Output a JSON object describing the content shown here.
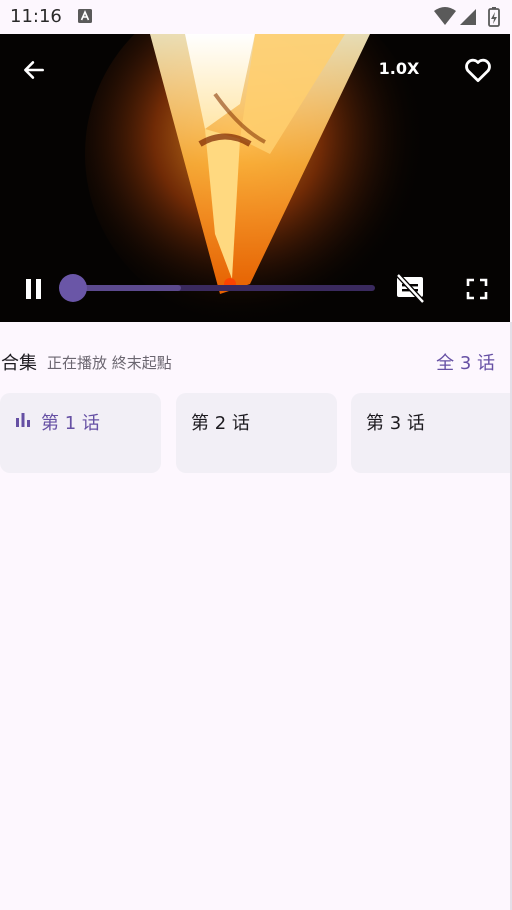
{
  "status_bar": {
    "time": "11:16",
    "icons": [
      "accessibility-icon",
      "wifi-icon",
      "signal-icon",
      "battery-icon"
    ]
  },
  "player": {
    "back_icon": "arrow-left-icon",
    "speed_label": "1.0X",
    "favorite_icon": "heart-outline-icon",
    "play_state_icon": "pause-icon",
    "subtitles_icon": "subtitles-off-icon",
    "fullscreen_icon": "fullscreen-icon",
    "progress_fraction": 0.0,
    "buffered_fraction": 0.36,
    "accent_color": "#6a56a7"
  },
  "episodes": {
    "title": "合集",
    "now_playing": "正在播放 終末起點",
    "total": "全 3 话",
    "items": [
      {
        "label": "第 1 话",
        "active": true,
        "icon": "equalizer-icon"
      },
      {
        "label": "第 2 话",
        "active": false
      },
      {
        "label": "第 3 话",
        "active": false
      }
    ],
    "accent_color": "#6650a4"
  }
}
